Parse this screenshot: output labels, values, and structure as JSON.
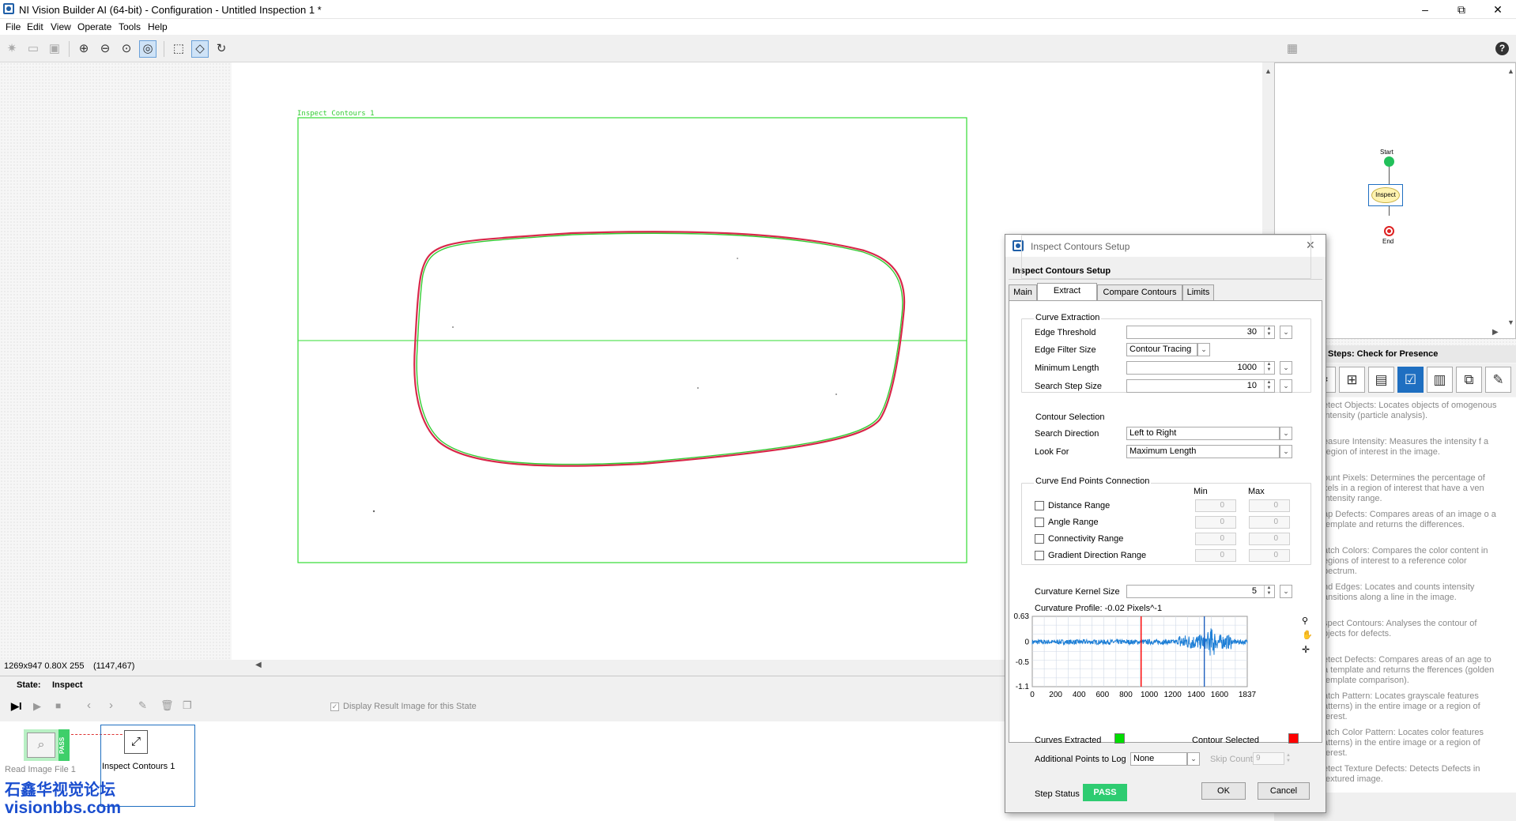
{
  "window": {
    "title": "NI Vision Builder AI (64-bit) - Configuration - Untitled Inspection 1 *",
    "controls": [
      "–",
      "⧉",
      "✕"
    ]
  },
  "menu": [
    "File",
    "Edit",
    "View",
    "Operate",
    "Tools",
    "Help"
  ],
  "toolbar": {
    "icons": [
      "new-icon",
      "open-icon",
      "save-icon",
      "zoom-in-icon",
      "zoom-out-icon",
      "zoom-fit-icon",
      "zoom-1to1-icon",
      "rectangle-tool-icon",
      "pan-tool-icon",
      "rotate-tool-icon"
    ]
  },
  "canvas": {
    "roi_label": "Inspect Contours 1"
  },
  "status": {
    "image_info": "1269x947 0.80X 255",
    "coords": "(1147,467)"
  },
  "state_bar": {
    "label": "State:",
    "value": "Inspect"
  },
  "state_controls": {
    "display_result": "Display Result Image for this State"
  },
  "filmstrip": {
    "items": [
      {
        "label": "Read Image File 1",
        "badge": "PASS"
      },
      {
        "label": "Inspect Contours 1"
      }
    ]
  },
  "watermark": {
    "line1": "石鑫华视觉论坛",
    "line2": "visionbbs.com"
  },
  "flowchart": {
    "start": "Start",
    "inspect": "Inspect",
    "end": "End"
  },
  "steps_panel": {
    "header": "Steps: Check for Presence",
    "descriptions": [
      "etect Objects: Locates objects of omogenous intensity (particle analysis).",
      "easure Intensity: Measures the intensity f a region of interest in the image.",
      "ount Pixels: Determines the percentage of xels in a region of interest that have a ven intensity range.",
      "ap Defects: Compares areas of an image o a template and returns the differences.",
      "atch Colors: Compares the color content in egions of interest to a reference color pectrum.",
      "nd Edges: Locates and counts intensity ansitions along a line in the image.",
      "spect Contours: Analyses the contour of bjects for defects.",
      "etect Defects: Compares areas of an age to a template and returns the fferences (golden template comparison).",
      "atch Pattern: Locates grayscale features atterns) in the entire image or a region of terest.",
      "atch Color Pattern: Locates color features atterns) in the entire image or a region of terest.",
      "etect Texture Defects: Detects Defects in textured image."
    ]
  },
  "dialog": {
    "title": "Inspect Contours Setup",
    "header": "Inspect Contours Setup",
    "tabs": [
      "Main",
      "Extract Contour",
      "Compare Contours",
      "Limits"
    ],
    "curve_extraction": {
      "title": "Curve Extraction",
      "edge_threshold_label": "Edge Threshold",
      "edge_threshold": "30",
      "edge_filter_label": "Edge Filter Size",
      "edge_filter": "Contour Tracing",
      "min_length_label": "Minimum Length",
      "min_length": "1000",
      "search_step_label": "Search Step Size",
      "search_step": "10"
    },
    "contour_selection": {
      "title": "Contour Selection",
      "search_direction_label": "Search Direction",
      "search_direction": "Left to Right",
      "look_for_label": "Look For",
      "look_for": "Maximum Length"
    },
    "endpoints": {
      "title": "Curve End Points Connection",
      "min_label": "Min",
      "max_label": "Max",
      "rows": [
        {
          "label": "Distance Range",
          "min": "0",
          "max": "0"
        },
        {
          "label": "Angle Range",
          "min": "0",
          "max": "0"
        },
        {
          "label": "Connectivity Range",
          "min": "0",
          "max": "0"
        },
        {
          "label": "Gradient Direction Range",
          "min": "0",
          "max": "0"
        }
      ]
    },
    "curvature_kernel_label": "Curvature Kernel Size",
    "curvature_kernel": "5",
    "profile_label": "Curvature Profile: -0.02 Pixels^-1",
    "curves_extracted_label": "Curves Extracted",
    "contour_selected_label": "Contour Selected",
    "additional_points_label": "Additional Points to Log",
    "additional_points": "None",
    "skip_count_label": "Skip Count",
    "skip_count": "9",
    "step_status_label": "Step Status",
    "step_status": "PASS",
    "ok": "OK",
    "cancel": "Cancel",
    "colors": {
      "curves_extracted": "#00dd00",
      "contour_selected": "#ff0000",
      "pass": "#2ecc71"
    }
  },
  "chart_data": {
    "type": "line",
    "title": "",
    "xlabel": "",
    "ylabel": "",
    "xlim": [
      0,
      1837
    ],
    "ylim": [
      -1.1,
      0.63
    ],
    "x_ticks": [
      "0",
      "200",
      "400",
      "600",
      "800",
      "1000",
      "1200",
      "1400",
      "1600",
      "1837"
    ],
    "y_ticks": [
      "0.63",
      "0",
      "-0.5",
      "-1.1"
    ],
    "series": [
      {
        "values_note_count": 0
      }
    ],
    "markers": [
      {
        "x": 930,
        "color": "#ff0000"
      },
      {
        "x": 1470,
        "color": "#1f5fbf"
      }
    ],
    "grid": true
  }
}
